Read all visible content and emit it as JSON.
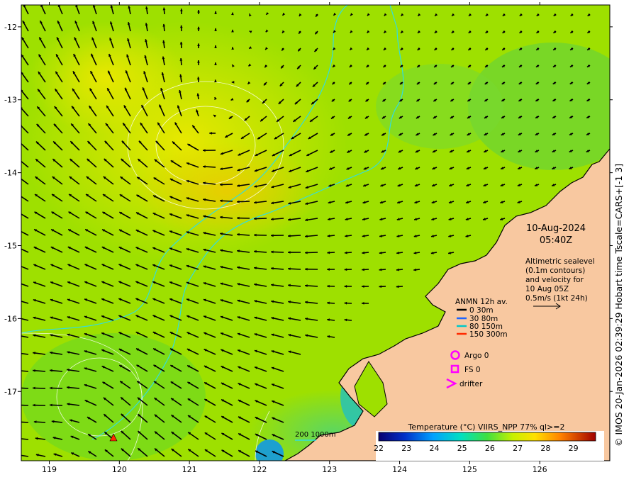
{
  "map": {
    "x_ticks": [
      "119",
      "120",
      "121",
      "122",
      "123",
      "124",
      "125",
      "126"
    ],
    "y_ticks": [
      "-12",
      "-13",
      "-14",
      "-15",
      "-16",
      "-17"
    ],
    "lon_range": [
      118.6,
      127.0
    ],
    "lat_range": [
      -17.95,
      -11.7
    ]
  },
  "annotation": {
    "date": "10-Aug-2024",
    "time": "05:40Z",
    "caption": [
      "Altimetric sealevel",
      "(0.1m contours)",
      "and velocity for",
      "10 Aug 05Z",
      "0.5m/s (1kt 24h)"
    ]
  },
  "legend": {
    "title": "ANMN 12h av.",
    "items": [
      {
        "label": "0 30m",
        "color": "#000000"
      },
      {
        "label": "30 80m",
        "color": "#1e64ff"
      },
      {
        "label": "80 150m",
        "color": "#00c8c8"
      },
      {
        "label": "150 300m",
        "color": "#ff2a00"
      }
    ],
    "argo_label": "Argo 0",
    "fs_label": "FS 0",
    "drifter_label": "drifter",
    "marker_color": "#ff00ff"
  },
  "bathymetry_label": "200  1000m",
  "colorbar": {
    "title": "Temperature (°C) VIIRS_NPP 77% ql>=2",
    "ticks": [
      "22",
      "23",
      "24",
      "25",
      "26",
      "27",
      "28",
      "29"
    ],
    "range": [
      22,
      29.8
    ]
  },
  "credit": "© IMOS 20-Jan-2026 02:39:29 Hobart time Tscale=CARS+[-1 3]",
  "colors": {
    "land": "#f8c8a0",
    "sea_main": "#9ee000",
    "coast": "#000000",
    "isobath": "#33dddd"
  }
}
